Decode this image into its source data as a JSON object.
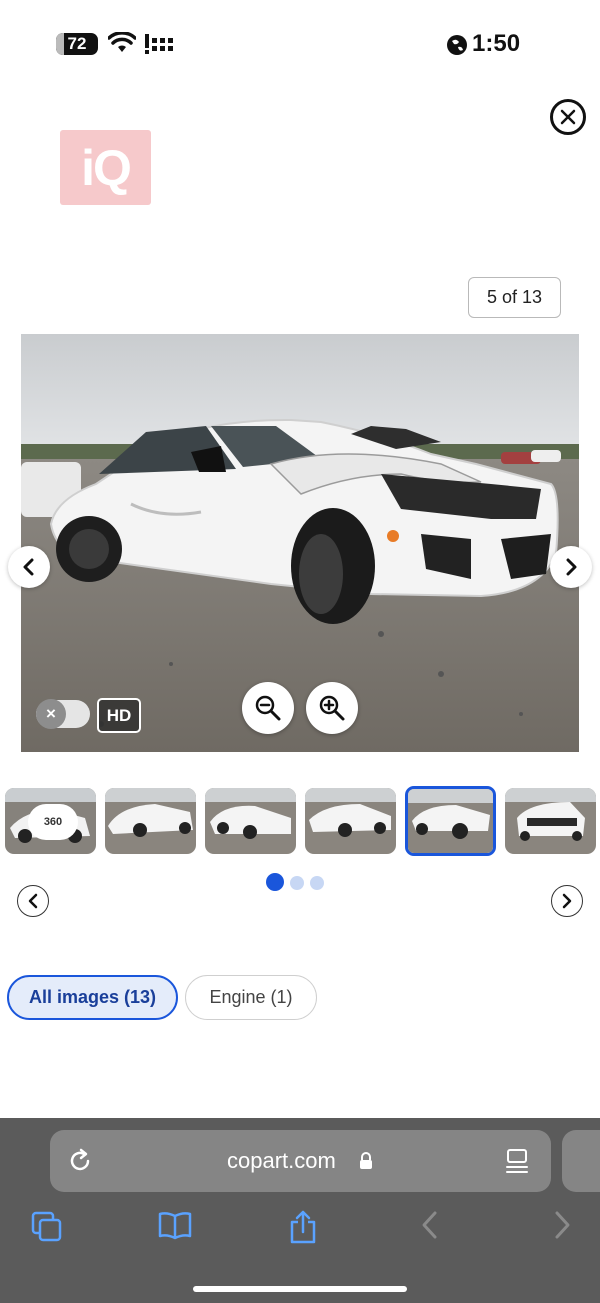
{
  "status_bar": {
    "battery": "72",
    "time": "1:50",
    "icons": [
      "battery-icon",
      "wifi-icon",
      "signal-icon",
      "globe-icon"
    ]
  },
  "viewer": {
    "logo_text": "iQ",
    "counter": "5 of 13",
    "hd_label": "HD",
    "toggle_label": "×",
    "badge_360": "360",
    "dots_total": 3,
    "active_dot": 1,
    "thumbnails_visible": 6,
    "active_thumbnail": 5
  },
  "tabs": [
    {
      "label": "All images (13)",
      "active": true
    },
    {
      "label": "Engine (1)",
      "active": false
    }
  ],
  "browser": {
    "url": "copart.com",
    "icons": [
      "reload-icon",
      "lock-icon",
      "reader-icon",
      "tabs-icon",
      "bookmarks-icon",
      "share-icon",
      "back-icon",
      "forward-icon"
    ]
  },
  "colors": {
    "accent": "#1a56db",
    "tab_active_bg": "#e4ecfa",
    "logo_bg": "#f6c9cb",
    "browser_bg": "#5b5b5b"
  }
}
